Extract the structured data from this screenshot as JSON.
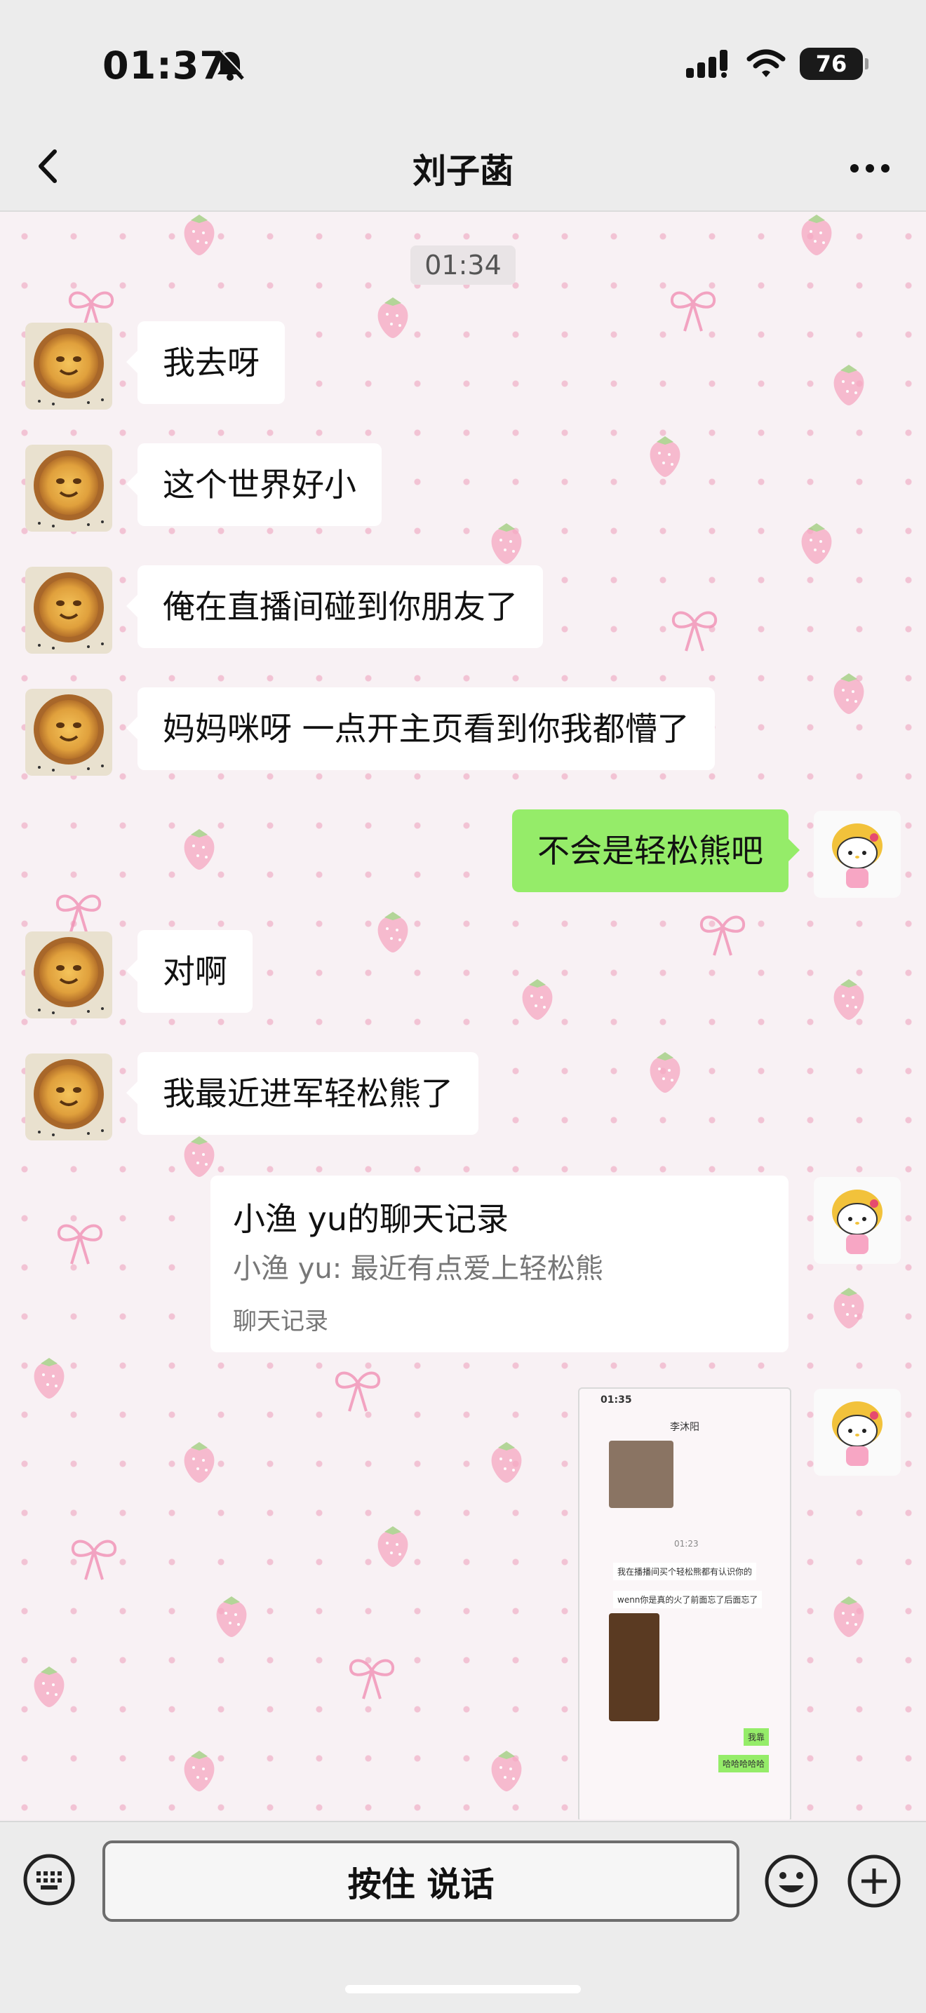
{
  "status": {
    "time": "01:37",
    "battery": "76"
  },
  "header": {
    "title": "刘子菡"
  },
  "chat": {
    "timestamp": "01:34",
    "messages": [
      {
        "side": "in",
        "text": "我去呀"
      },
      {
        "side": "in",
        "text": "这个世界好小"
      },
      {
        "side": "in",
        "text": "俺在直播间碰到你朋友了"
      },
      {
        "side": "in",
        "text": "妈妈咪呀 一点开主页看到你我都懵了"
      },
      {
        "side": "out",
        "text": "不会是轻松熊吧"
      },
      {
        "side": "in",
        "text": "对啊"
      },
      {
        "side": "in",
        "text": "我最近进军轻松熊了"
      }
    ],
    "forward_card": {
      "title": "小渔 yu的聊天记录",
      "preview": "小渔 yu: 最近有点爱上轻松熊",
      "label": "聊天记录"
    },
    "screenshot": {
      "time": "01:35",
      "title": "李沐阳",
      "timestamp": "01:23",
      "msg1": "我在播播间买个轻松熊都有认识你的",
      "msg2": "wenn你是真的火了前面忘了后面忘了",
      "reply1": "我靠",
      "reply2": "哈哈哈哈哈"
    }
  },
  "input_bar": {
    "hold_label": "按住 说话"
  },
  "colors": {
    "out_bubble": "#95ec69",
    "in_bubble": "#ffffff",
    "bar": "#ececec"
  }
}
